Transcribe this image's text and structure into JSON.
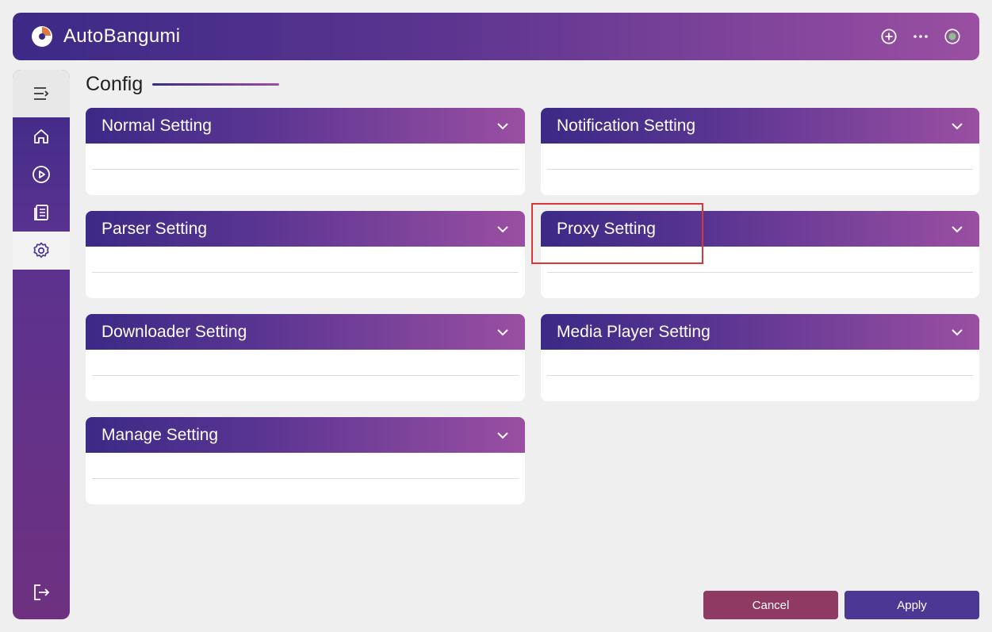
{
  "app": {
    "title": "AutoBangumi"
  },
  "header_actions": [
    {
      "icon": "add-circle-icon"
    },
    {
      "icon": "more-icon"
    },
    {
      "icon": "status-indicator-icon"
    }
  ],
  "sidebar": {
    "items": [
      {
        "icon": "menu-toggle-icon"
      },
      {
        "icon": "home-icon"
      },
      {
        "icon": "play-icon"
      },
      {
        "icon": "log-icon"
      },
      {
        "icon": "settings-icon",
        "active": true
      },
      {
        "icon": "logout-icon"
      }
    ]
  },
  "page": {
    "title": "Config"
  },
  "panels": [
    {
      "title": "Normal Setting"
    },
    {
      "title": "Notification Setting"
    },
    {
      "title": "Parser Setting"
    },
    {
      "title": "Proxy Setting"
    },
    {
      "title": "Downloader Setting"
    },
    {
      "title": "Media Player Setting"
    },
    {
      "title": "Manage Setting"
    }
  ],
  "actions": {
    "cancel_label": "Cancel",
    "apply_label": "Apply"
  },
  "colors": {
    "accent_dark": "#3b2a86",
    "accent_light": "#9a4fa2",
    "cancel": "#8f3a63",
    "apply": "#4b3894",
    "highlight": "#d9383a"
  }
}
